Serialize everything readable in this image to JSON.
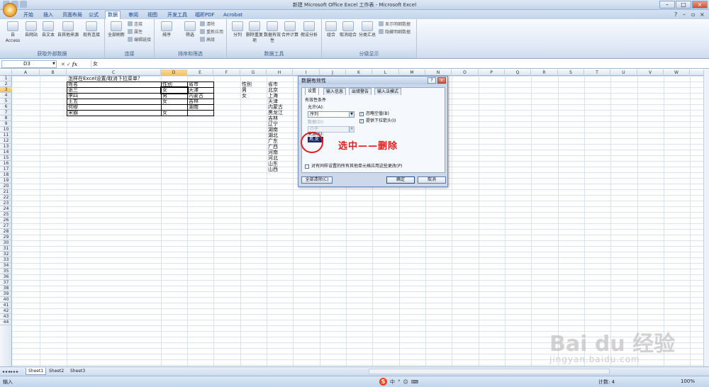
{
  "window": {
    "title": "新建 Microsoft Office Excel 工作表 - Microsoft Excel"
  },
  "ribbon_tabs": [
    "开始",
    "插入",
    "页面布局",
    "公式",
    "数据",
    "审阅",
    "视图",
    "开发工具",
    "福昕PDF",
    "Acrobat"
  ],
  "active_tab": "数据",
  "ribbon": {
    "groups": [
      {
        "label": "获取外部数据",
        "buttons": [
          "自 Access",
          "自网站",
          "自文本",
          "自其他来源",
          "现有连接"
        ]
      },
      {
        "label": "连接",
        "buttons": [
          "全部刷新"
        ],
        "small": [
          "连接",
          "属性",
          "编辑链接"
        ]
      },
      {
        "label": "排序和筛选",
        "buttons": [
          "排序",
          "筛选"
        ],
        "small": [
          "清除",
          "重新应用",
          "高级"
        ]
      },
      {
        "label": "数据工具",
        "buttons": [
          "分列",
          "删除重复项",
          "数据有效性",
          "合并计算",
          "假设分析"
        ]
      },
      {
        "label": "分级显示",
        "buttons": [
          "组合",
          "取消组合",
          "分类汇总"
        ],
        "small": [
          "显示明细数据",
          "隐藏明细数据"
        ]
      }
    ]
  },
  "formula_bar": {
    "name_box": "D3",
    "fx": "fx",
    "value": "女"
  },
  "columns": [
    "A",
    "B",
    "C",
    "D",
    "E",
    "F",
    "G",
    "H",
    "I",
    "J",
    "K",
    "L",
    "M",
    "N",
    "O",
    "P",
    "Q",
    "R",
    "S",
    "T",
    "U",
    "V",
    "W"
  ],
  "selected_column": "D",
  "selected_row": 3,
  "rows": [
    "1",
    "2",
    "3",
    "4",
    "5",
    "6",
    "7",
    "8",
    "9",
    "10",
    "11",
    "12",
    "13",
    "14",
    "15",
    "16",
    "17",
    "18",
    "19",
    "20",
    "21",
    "22",
    "23",
    "24",
    "25",
    "26",
    "27",
    "28",
    "29",
    "30",
    "31",
    "32",
    "33",
    "34",
    "35",
    "36",
    "37",
    "38",
    "39",
    "40",
    "41",
    "42",
    "43",
    "44"
  ],
  "sheet": {
    "heading": "怎样在Excel设置/取消下拉菜单？",
    "table_headers": [
      "姓名",
      "性别",
      "省市"
    ],
    "table_rows": [
      [
        "张三",
        "女",
        "天津"
      ],
      [
        "李四",
        "男",
        "内蒙古"
      ],
      [
        "王五",
        "女",
        "吉林"
      ],
      [
        "何穆",
        "",
        "湖南"
      ],
      [
        "宋霸",
        "女",
        ""
      ]
    ],
    "gender_list_header": "性别",
    "gender_list": [
      "男",
      "女"
    ],
    "province_list_header": "省市",
    "province_list": [
      "北京",
      "上海",
      "天津",
      "内蒙古",
      "黑龙江",
      "吉林",
      "辽宁",
      "湖南",
      "湖北",
      "广东",
      "广西",
      "河南",
      "河北",
      "山东",
      "山西"
    ]
  },
  "dialog": {
    "title": "数据有效性",
    "help": "?",
    "close": "×",
    "tabs": [
      "设置",
      "输入信息",
      "出错警告",
      "输入法模式"
    ],
    "section": "有效性条件",
    "allow_label": "允许(A):",
    "allow_value": "序列",
    "data_label": "数据(D):",
    "data_value": "介于",
    "ignore_blank": "忽略空值(B)",
    "dropdown_arrow": "提供下拉箭头(I)",
    "source_label": "来源(S):",
    "source_value": "男,女",
    "apply_all": "对有同样设置的所有其他单元格应用这些更改(P)",
    "clear_all": "全部清除(C)",
    "ok": "确定",
    "cancel": "取消"
  },
  "annotation": {
    "text": "选中——删除",
    "color": "#e02020"
  },
  "sheet_tabs": [
    "Sheet1",
    "Sheet2",
    "Sheet3"
  ],
  "status": {
    "mode": "输入",
    "count": "计数: 4",
    "zoom": "100%"
  },
  "ime": {
    "logo": "S",
    "items": [
      "中",
      "°",
      "☺",
      "⌨"
    ]
  },
  "watermark": {
    "text": "Bai du 经验",
    "url": "jingyan.baidu.com"
  }
}
